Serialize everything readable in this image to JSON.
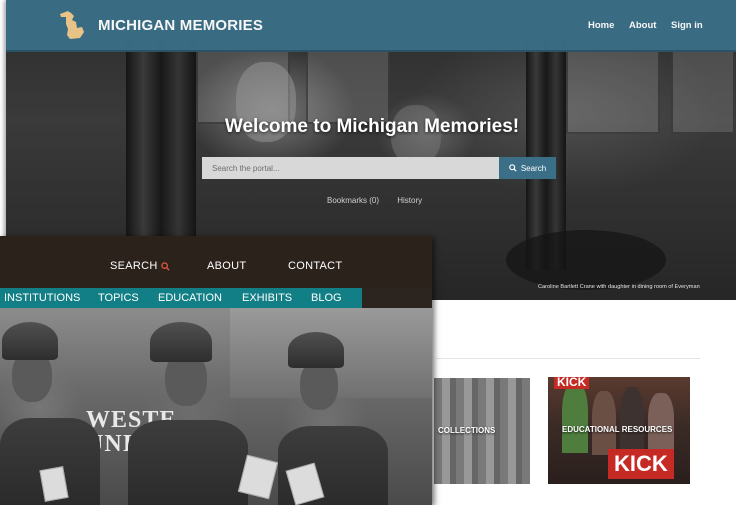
{
  "back_site": {
    "title": "MICHIGAN MEMORIES",
    "nav": [
      "Home",
      "About",
      "Sign in"
    ],
    "welcome": "Welcome to Michigan Memories!",
    "search": {
      "placeholder": "Search the portal...",
      "button_label": "Search"
    },
    "links": [
      "Bookmarks (0)",
      "History"
    ],
    "caption": "Caroline Bartlett Crane with daughter in dining room of Everyman",
    "cards": [
      {
        "label": "COLLECTIONS"
      },
      {
        "label": "EDUCATIONAL RESOURCES"
      }
    ],
    "card_badge": "KICK",
    "colors": {
      "brand": "#3a6f87"
    }
  },
  "front_site": {
    "top_nav": [
      "SEARCH",
      "ABOUT",
      "CONTACT"
    ],
    "sub_nav": [
      "INSTITUTIONS",
      "TOPICS",
      "EDUCATION",
      "EXHIBITS",
      "BLOG"
    ],
    "photo_sign": [
      "WESTE",
      "UNI"
    ],
    "colors": {
      "subnav": "#127f86",
      "header": "#2c221c",
      "search_icon": "#e0553d"
    }
  }
}
